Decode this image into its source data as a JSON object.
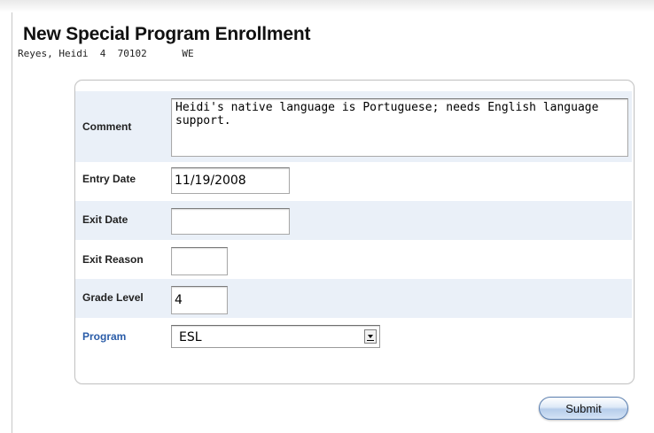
{
  "page": {
    "title": "New Special Program Enrollment",
    "student_info": "Reyes, Heidi  4  70102      WE"
  },
  "form": {
    "comment": {
      "label": "Comment",
      "value": "Heidi's native language is Portuguese; needs English language support."
    },
    "entry_date": {
      "label": "Entry Date",
      "value": "11/19/2008"
    },
    "exit_date": {
      "label": "Exit Date",
      "value": ""
    },
    "exit_reason": {
      "label": "Exit Reason",
      "value": ""
    },
    "grade_level": {
      "label": "Grade Level",
      "value": "4"
    },
    "program": {
      "label": "Program",
      "selected": "ESL"
    }
  },
  "actions": {
    "submit_label": "Submit"
  },
  "colors": {
    "shaded_row": "#eaf0f8",
    "link_label": "#2a5ca8",
    "submit_accent": "#b6cdeb"
  }
}
